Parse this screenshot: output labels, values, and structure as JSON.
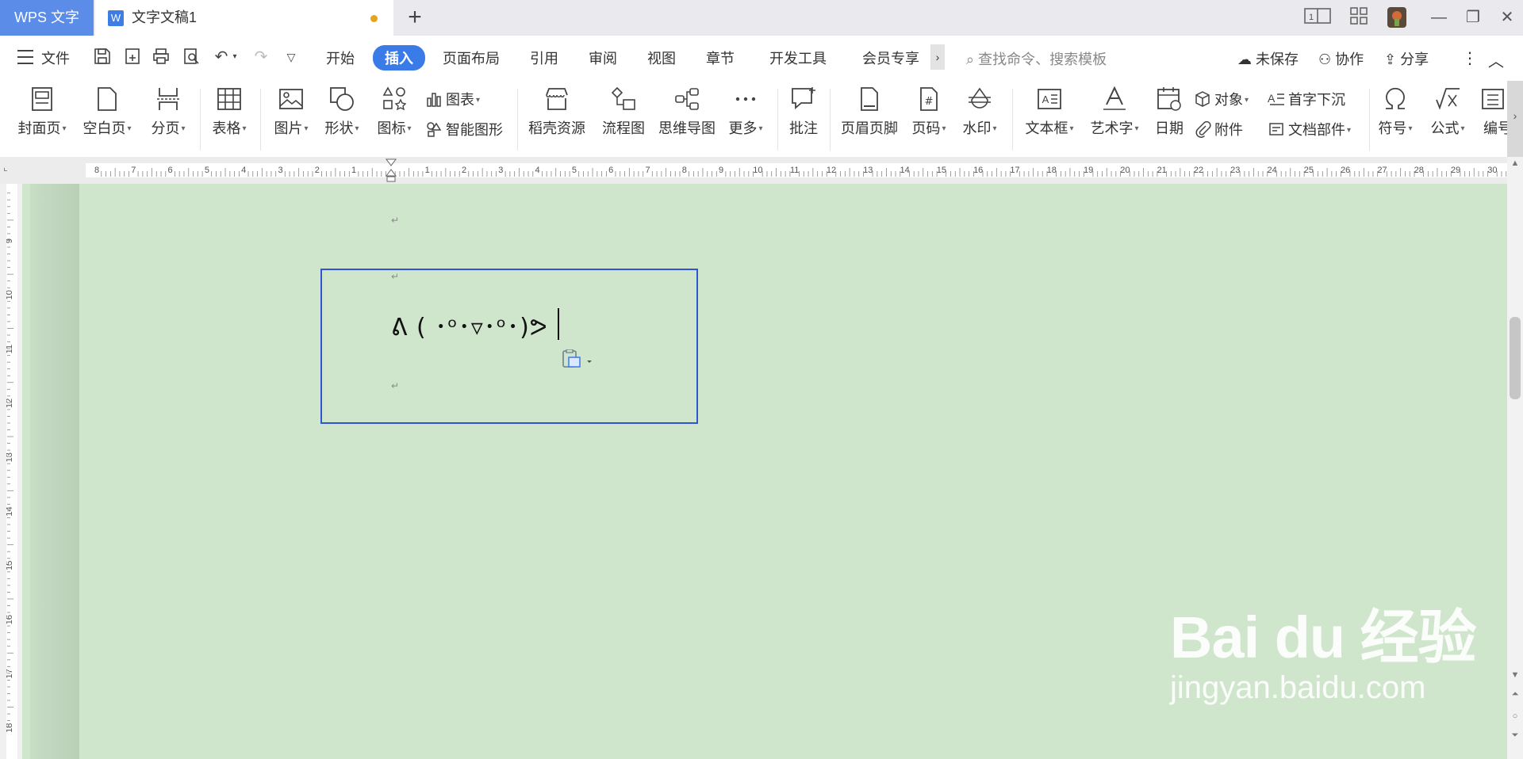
{
  "titlebar": {
    "app_tab": "WPS 文字",
    "doc_tab": "文字文稿1",
    "doc_icon_letter": "W",
    "page_counter": "1"
  },
  "menubar": {
    "file": "文件",
    "tabs": [
      "开始",
      "插入",
      "页面布局",
      "引用",
      "审阅",
      "视图",
      "章节",
      "开发工具",
      "会员专享"
    ],
    "active_tab": "插入",
    "search_placeholder": "查找命令、搜索模板",
    "unsaved": "未保存",
    "collaborate": "协作",
    "share": "分享"
  },
  "ribbon": {
    "cover": "封面页",
    "blank_page": "空白页",
    "page_break": "分页",
    "table": "表格",
    "picture": "图片",
    "shape": "形状",
    "icon": "图标",
    "chart": "图表",
    "smart_art": "智能图形",
    "daoke": "稻壳资源",
    "flowchart": "流程图",
    "mindmap": "思维导图",
    "more": "更多",
    "comment": "批注",
    "header_footer": "页眉页脚",
    "page_number": "页码",
    "watermark": "水印",
    "textbox": "文本框",
    "wordart": "艺术字",
    "date": "日期",
    "object": "对象",
    "attachment": "附件",
    "drop_cap": "首字下沉",
    "doc_parts": "文档部件",
    "symbol": "符号",
    "formula": "公式",
    "numbering": "编号"
  },
  "ruler": {
    "h_labels": [
      "8",
      "7",
      "6",
      "5",
      "4",
      "3",
      "2",
      "1",
      "",
      "1",
      "2",
      "3",
      "4",
      "5",
      "6",
      "7",
      "8",
      "9",
      "10",
      "11",
      "12",
      "13",
      "14",
      "15",
      "16",
      "17",
      "18",
      "19",
      "20",
      "21",
      "22",
      "23",
      "24",
      "25",
      "26",
      "27",
      "28",
      "29",
      "30"
    ],
    "v_labels": [
      "9",
      "10",
      "11",
      "12",
      "13",
      "14",
      "15",
      "16",
      "17",
      "18"
    ]
  },
  "document": {
    "kaomoji": "ᕕ ( ･ᵒ･▿･ᵒ･)ᕗ",
    "para_mark": "↵"
  },
  "watermark": {
    "main": "Bai du 经验",
    "sub": "jingyan.baidu.com"
  },
  "colors": {
    "accent": "#3a7be8",
    "app_tab": "#5b8ce8",
    "canvas": "#cfe6cc",
    "textbox_border": "#2d56d0",
    "unsaved_dot": "#e8a317"
  }
}
